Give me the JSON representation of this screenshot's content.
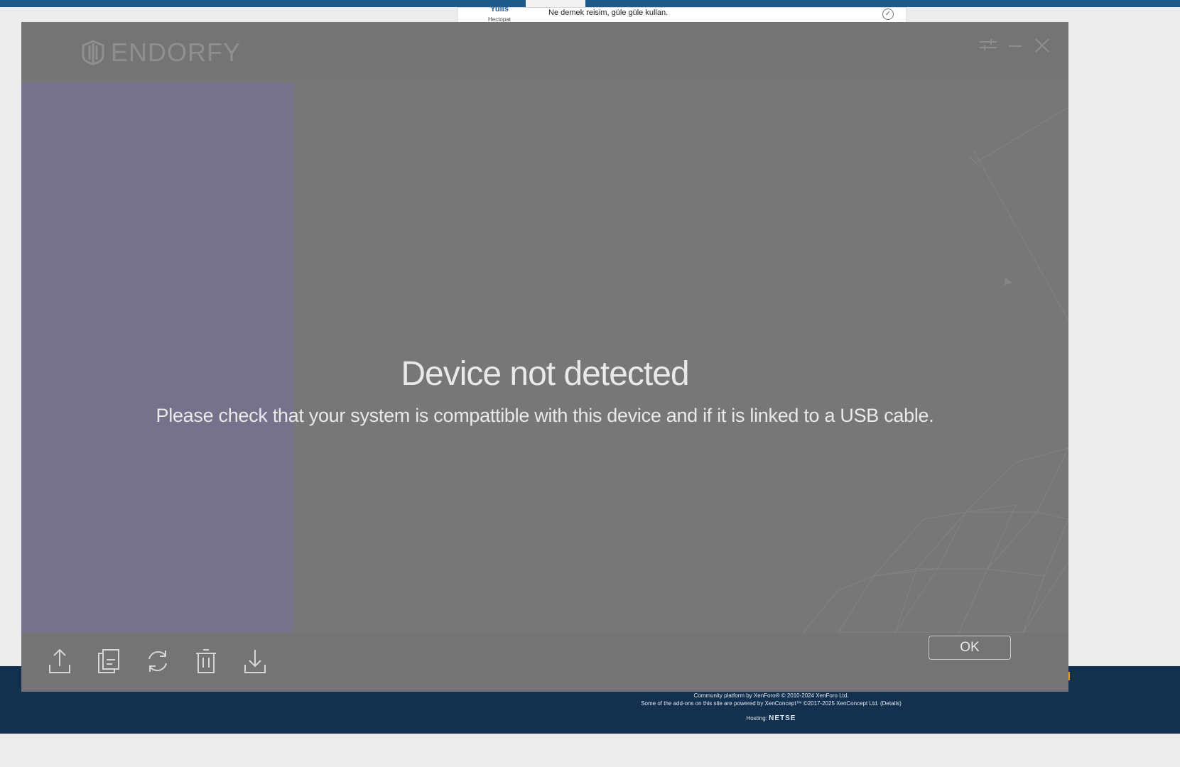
{
  "background_page": {
    "post_user": "Yuiis",
    "post_user_title": "Hectopat",
    "post_message": "Ne demek reisim, güle güle kullan.",
    "footer": {
      "line1": "Community platform by XenForo® © 2010-2024 XenForo Ltd.",
      "line2": "Some of the add-ons on this site are powered by XenConcept™ ©2017-2025 XenConcept Ltd. (Details)",
      "hosting_label": "Hosting:",
      "hosting_brand": "NETSE"
    }
  },
  "app": {
    "brand": "ENDORFY",
    "status_title": "Device not detected",
    "status_message": "Please check that your system is compattible with this device and if it is linked to a USB cable.",
    "ok_label": "OK",
    "toolbar_icons": [
      "upload-icon",
      "copy-icon",
      "refresh-icon",
      "delete-icon",
      "download-icon"
    ],
    "colors": {
      "window": "#777777",
      "left_panel": "#76728b",
      "text": "#e9e9e9"
    }
  }
}
